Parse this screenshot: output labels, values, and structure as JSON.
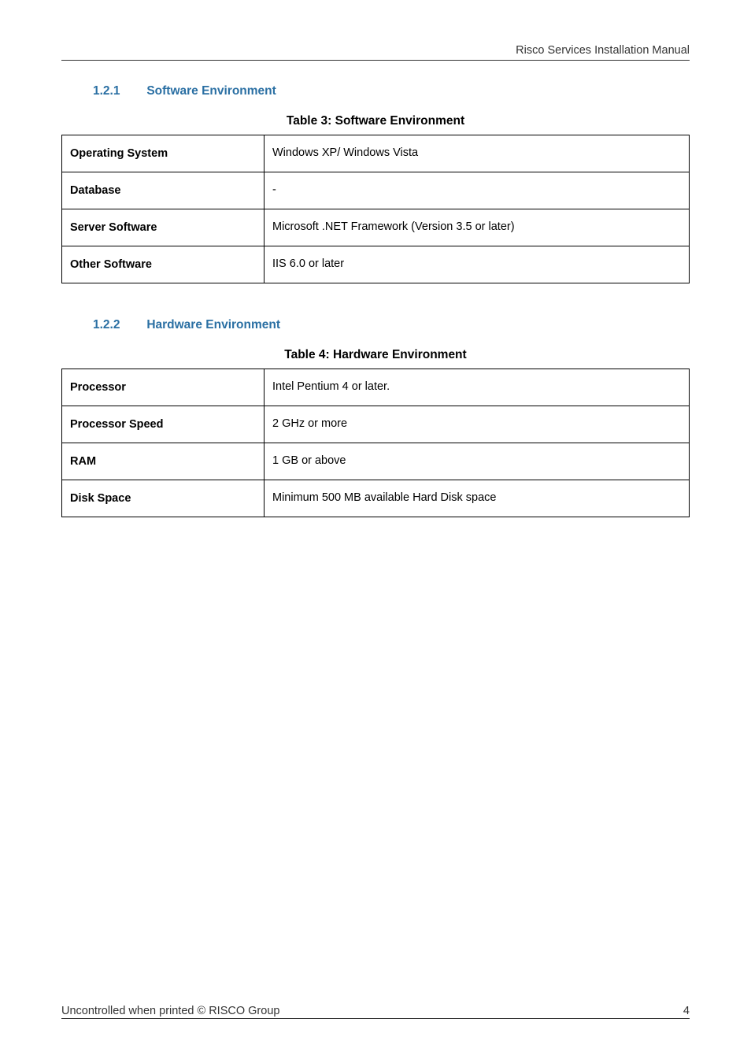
{
  "header": {
    "doc_title": "Risco Services Installation Manual"
  },
  "sections": {
    "s1": {
      "num": "1.2.1",
      "title": "Software Environment",
      "table_caption": "Table 3: Software Environment"
    },
    "s2": {
      "num": "1.2.2",
      "title": "Hardware Environment",
      "table_caption": "Table 4: Hardware Environment"
    }
  },
  "table3": {
    "rows": [
      {
        "label": "Operating System",
        "value": "Windows XP/ Windows Vista"
      },
      {
        "label": "Database",
        "value": "-"
      },
      {
        "label": "Server Software",
        "value": "Microsoft .NET Framework (Version 3.5 or later)"
      },
      {
        "label": "Other Software",
        "value": "IIS 6.0 or later"
      }
    ]
  },
  "table4": {
    "rows": [
      {
        "label": "Processor",
        "value": "Intel Pentium 4 or later."
      },
      {
        "label": "Processor Speed",
        "value": "2 GHz or more"
      },
      {
        "label": "RAM",
        "value": "1 GB or above"
      },
      {
        "label": "Disk Space",
        "value": "Minimum 500 MB available Hard Disk space"
      }
    ]
  },
  "footer": {
    "left": "Uncontrolled when printed © RISCO Group",
    "right": "4"
  }
}
